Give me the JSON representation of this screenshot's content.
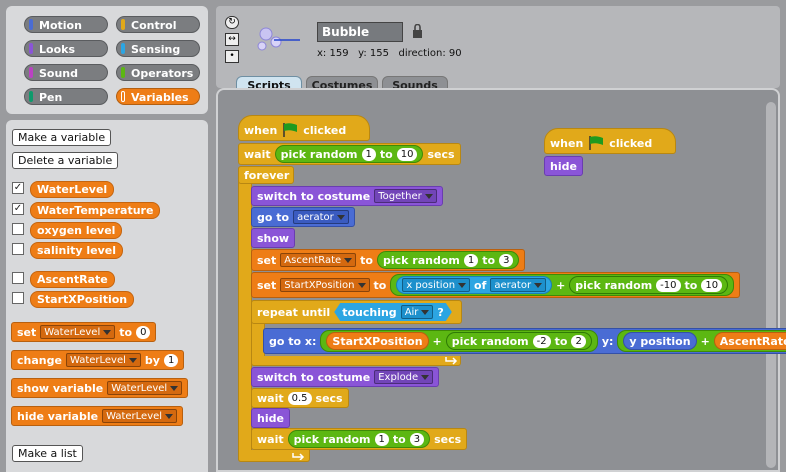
{
  "categories": [
    {
      "label": "Motion",
      "color": "#4a6cd4"
    },
    {
      "label": "Control",
      "color": "#e1a91a"
    },
    {
      "label": "Looks",
      "color": "#8a55d7"
    },
    {
      "label": "Sensing",
      "color": "#2ca5e2"
    },
    {
      "label": "Sound",
      "color": "#bb42c3"
    },
    {
      "label": "Operators",
      "color": "#5cb712"
    },
    {
      "label": "Pen",
      "color": "#0e9a6c"
    },
    {
      "label": "Variables",
      "color": "#ee7d16"
    }
  ],
  "palette": {
    "make_variable": "Make a variable",
    "delete_variable": "Delete a variable",
    "variables": [
      {
        "name": "WaterLevel",
        "checked": true
      },
      {
        "name": "WaterTemperature",
        "checked": true
      },
      {
        "name": "oxygen level",
        "checked": false
      },
      {
        "name": "salinity level",
        "checked": false
      },
      {
        "name": "AscentRate",
        "checked": false
      },
      {
        "name": "StartXPosition",
        "checked": false
      }
    ],
    "set_block": {
      "label": "set",
      "var": "WaterLevel",
      "to": "to",
      "value": "0"
    },
    "change_block": {
      "label": "change",
      "var": "WaterLevel",
      "by": "by",
      "value": "1"
    },
    "show_block": {
      "label": "show variable",
      "var": "WaterLevel"
    },
    "hide_block": {
      "label": "hide variable",
      "var": "WaterLevel"
    },
    "make_list": "Make a list"
  },
  "sprite": {
    "name": "Bubble",
    "x_label": "x:",
    "x": "159",
    "y_label": "y:",
    "y": "155",
    "direction_label": "direction:",
    "direction": "90"
  },
  "tabs": [
    "Scripts",
    "Costumes",
    "Sounds"
  ],
  "script1": {
    "hat": "when",
    "hat2": "clicked",
    "wait": "wait",
    "pick_random": "pick random",
    "to": "to",
    "secs": "secs",
    "r1a": "1",
    "r1b": "10",
    "forever": "forever",
    "switch_costume": "switch to costume",
    "costume1": "Together",
    "go_to": "go to",
    "go_target": "aerator",
    "show": "show",
    "set": "set",
    "set_var1": "AscentRate",
    "r2a": "1",
    "r2b": "3",
    "set_var2": "StartXPosition",
    "x_position": "x position",
    "of": "of",
    "of_target": "aerator",
    "plus": "+",
    "r3a": "-10",
    "r3b": "10",
    "repeat_until": "repeat until",
    "touching": "touching",
    "touch_target": "Air",
    "question": "?",
    "go_to_x": "go to x:",
    "r4a": "-2",
    "r4b": "2",
    "y_label": "y:",
    "y_position": "y position",
    "costume2": "Explode",
    "wait2": "0.5",
    "hide": "hide",
    "r5a": "1",
    "r5b": "3"
  },
  "script2": {
    "hat": "when",
    "hat2": "clicked",
    "hide": "hide"
  }
}
